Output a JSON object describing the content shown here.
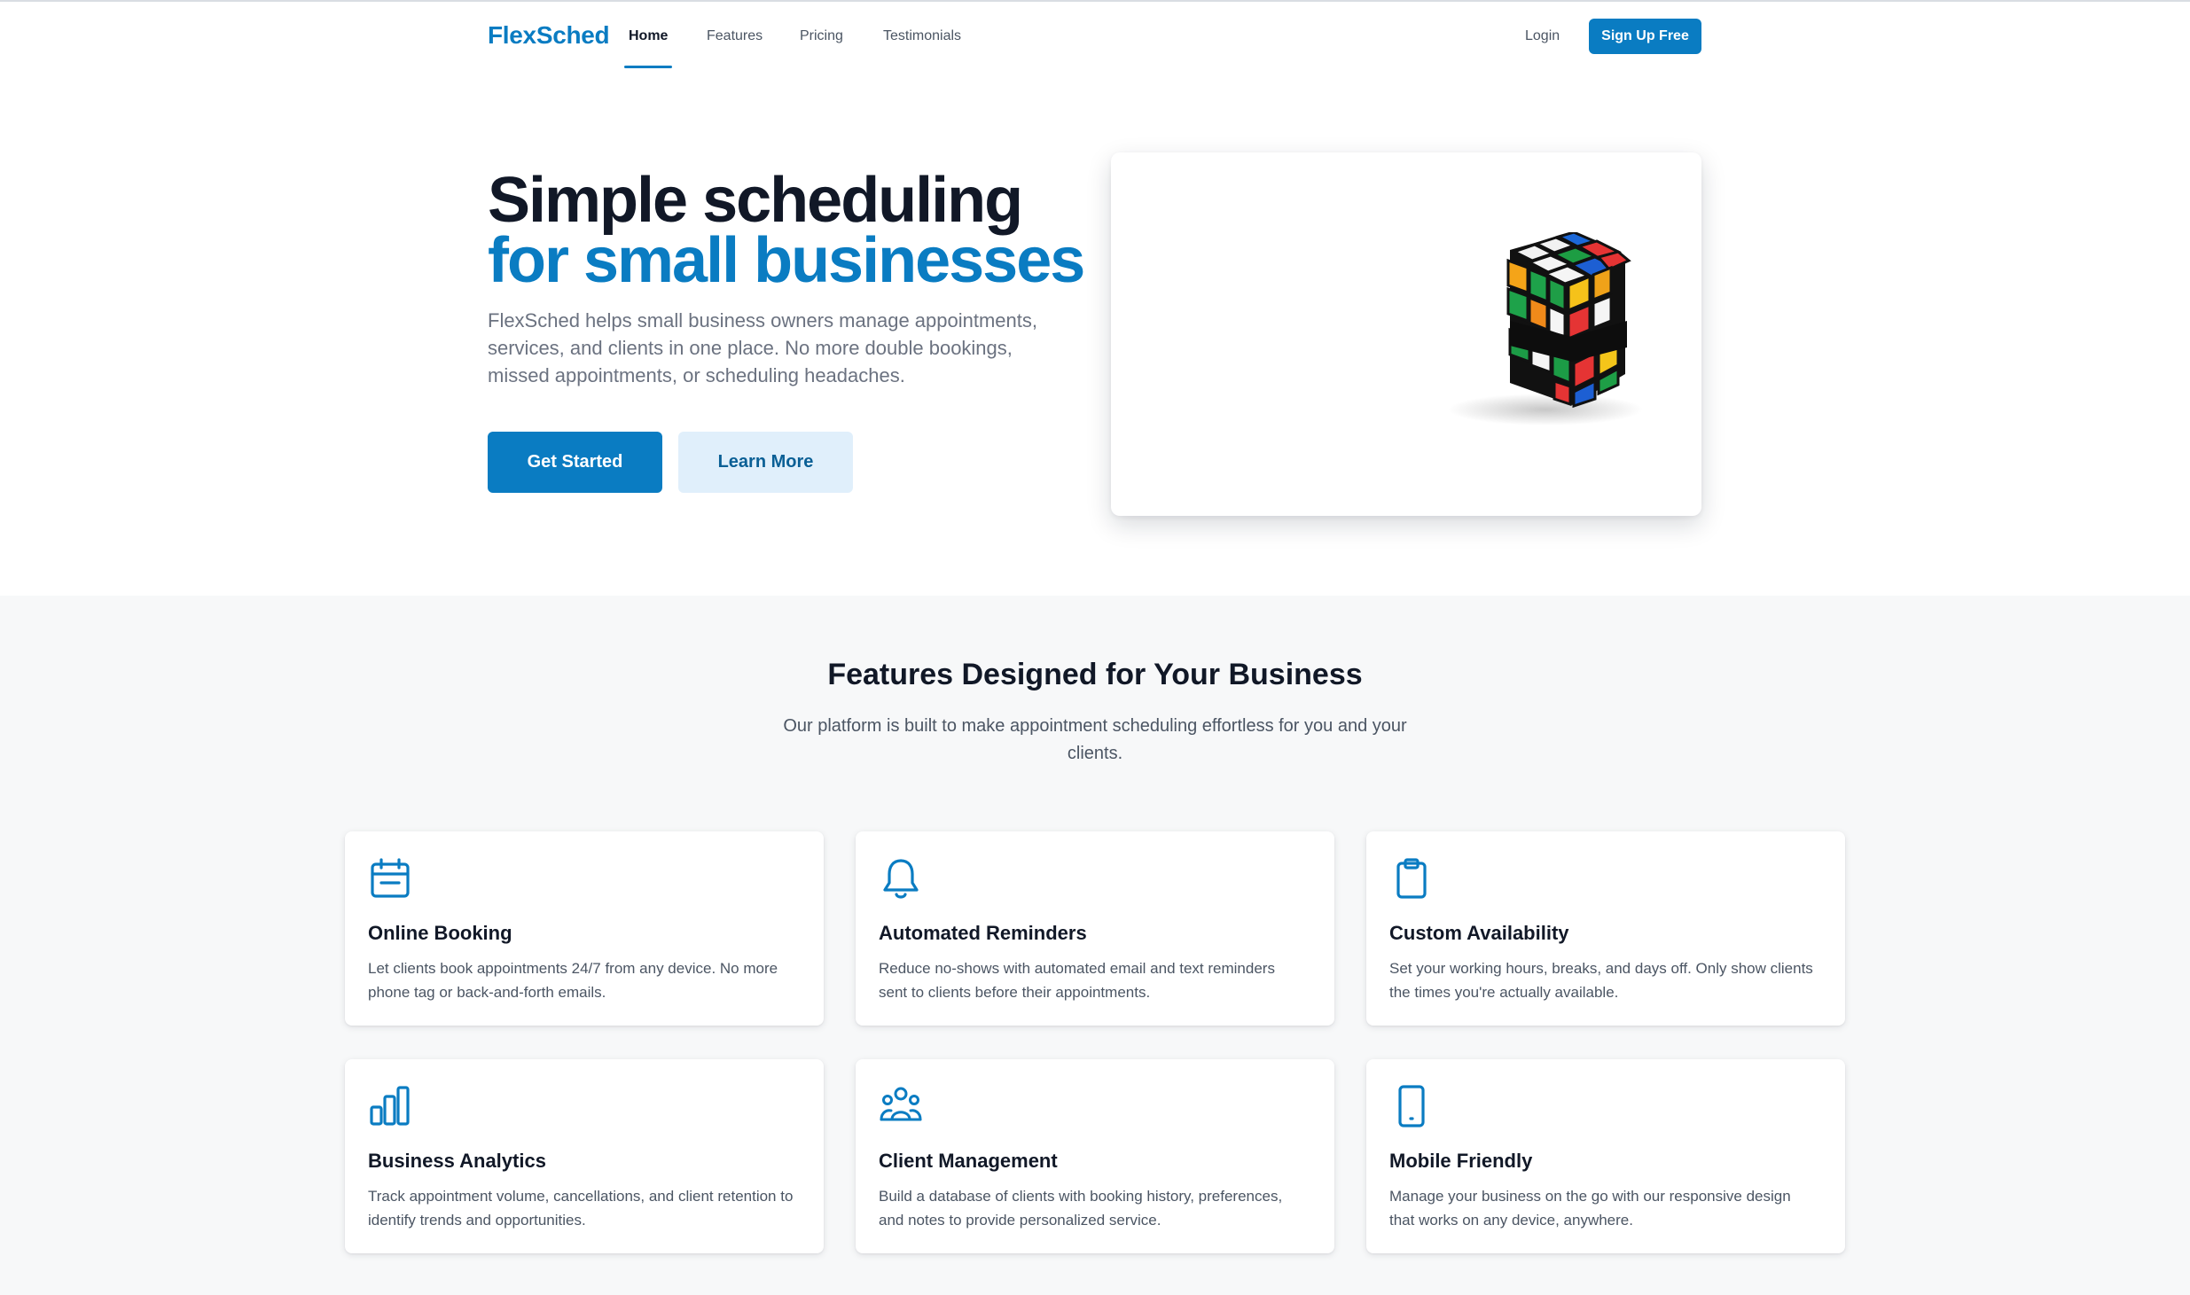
{
  "nav": {
    "logo": "FlexSched",
    "links": [
      "Home",
      "Features",
      "Pricing",
      "Testimonials"
    ],
    "active": "Home",
    "login": "Login",
    "signup": "Sign Up Free"
  },
  "hero": {
    "title_line1": "Simple scheduling",
    "title_line2": "for small businesses",
    "description": "FlexSched helps small business owners manage appointments, services, and clients in one place. No more double bookings, missed appointments, or scheduling headaches.",
    "primary_button": "Get Started",
    "secondary_button": "Learn More",
    "image": "rubiks-cube-image"
  },
  "features": {
    "title": "Features Designed for Your Business",
    "subtitle": "Our platform is built to make appointment scheduling effortless for you and your clients.",
    "items": [
      {
        "icon": "calendar-icon",
        "title": "Online Booking",
        "description": "Let clients book appointments 24/7 from any device. No more phone tag or back-and-forth emails."
      },
      {
        "icon": "bell-icon",
        "title": "Automated Reminders",
        "description": "Reduce no-shows with automated email and text reminders sent to clients before their appointments."
      },
      {
        "icon": "clipboard-icon",
        "title": "Custom Availability",
        "description": "Set your working hours, breaks, and days off. Only show clients the times you're actually available."
      },
      {
        "icon": "bar-chart-icon",
        "title": "Business Analytics",
        "description": "Track appointment volume, cancellations, and client retention to identify trends and opportunities."
      },
      {
        "icon": "users-icon",
        "title": "Client Management",
        "description": "Build a database of clients with booking history, preferences, and notes to provide personalized service."
      },
      {
        "icon": "phone-icon",
        "title": "Mobile Friendly",
        "description": "Manage your business on the go with our responsive design that works on any device, anywhere."
      }
    ]
  },
  "colors": {
    "brand": "#0a7cc2",
    "heading": "#111827",
    "muted": "#6b7280",
    "section_bg": "#f7f8f9",
    "secondary_button_bg": "#e0effb"
  }
}
